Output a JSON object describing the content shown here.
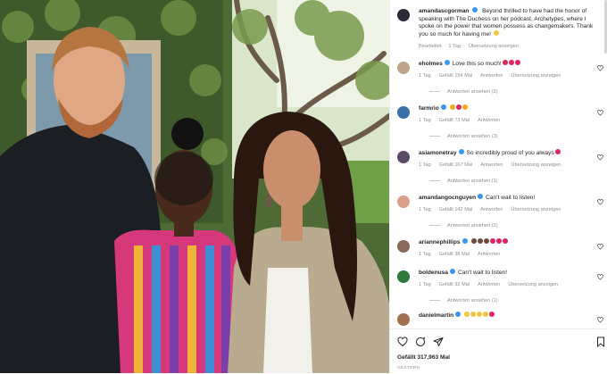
{
  "post": {
    "author": "amandascgorman",
    "caption": "Beyond thrilled to have had the honor of speaking with The Duchess on her podcast, Archetypes, where I spoke on the power that women possess as changemakers. Thank you so much for having me!",
    "edited": "Bearbeitet",
    "age": "1 Tag",
    "translate": "Übersetzung anzeigen",
    "likes": "Gefällt 317,963 Mal",
    "date": "GESTERN"
  },
  "labels": {
    "reply": "Antworten",
    "translate": "Übersetzung anzeigen"
  },
  "comments": [
    {
      "user": "eholmes",
      "text": "Love this so much!",
      "age": "1 Tag",
      "likes": "Gefällt 154 Mal",
      "translate": true,
      "replies": "Antworten ansehen (2)",
      "emoji": [
        "#e0245e",
        "#e0245e",
        "#e0245e"
      ]
    },
    {
      "user": "farmrio",
      "text": "",
      "age": "1 Tag",
      "likes": "Gefällt 73 Mal",
      "translate": false,
      "replies": "Antworten ansehen (3)",
      "emoji": [
        "#f5a623",
        "#e0245e",
        "#f5a623"
      ]
    },
    {
      "user": "asiamonetray",
      "text": "So incredibly proud of you always",
      "age": "1 Tag",
      "likes": "Gefällt 167 Mal",
      "translate": true,
      "replies": "Antworten ansehen (1)",
      "emoji": [
        "#e0245e"
      ]
    },
    {
      "user": "amandangocnguyen",
      "text": "Can't wait to listen!",
      "age": "1 Tag",
      "likes": "Gefällt 142 Mal",
      "translate": true,
      "replies": "Antworten ansehen (2)",
      "emoji": []
    },
    {
      "user": "ariannephillips",
      "text": "",
      "age": "1 Tag",
      "likes": "Gefällt 38 Mal",
      "translate": false,
      "replies": "",
      "emoji": [
        "#6b4a3a",
        "#6b4a3a",
        "#6b4a3a",
        "#e0245e",
        "#e0245e",
        "#e0245e"
      ]
    },
    {
      "user": "boldenusa",
      "text": "Can't wait to listen!",
      "age": "1 Tag",
      "likes": "Gefällt 92 Mal",
      "translate": true,
      "replies": "Antworten ansehen (1)",
      "emoji": []
    },
    {
      "user": "danielmartin",
      "text": "",
      "age": "",
      "likes": "",
      "translate": false,
      "replies": "",
      "emoji": [
        "#f5c542",
        "#f5c542",
        "#f5c542",
        "#f5c542",
        "#e0245e"
      ]
    }
  ],
  "icons": {
    "like": "heart-icon",
    "comment": "comment-icon",
    "share": "share-icon",
    "save": "bookmark-icon",
    "verified": "verified-badge-icon"
  },
  "colors": {
    "verified": "#3897f0",
    "muted": "#8e8e8e",
    "text": "#262626"
  }
}
